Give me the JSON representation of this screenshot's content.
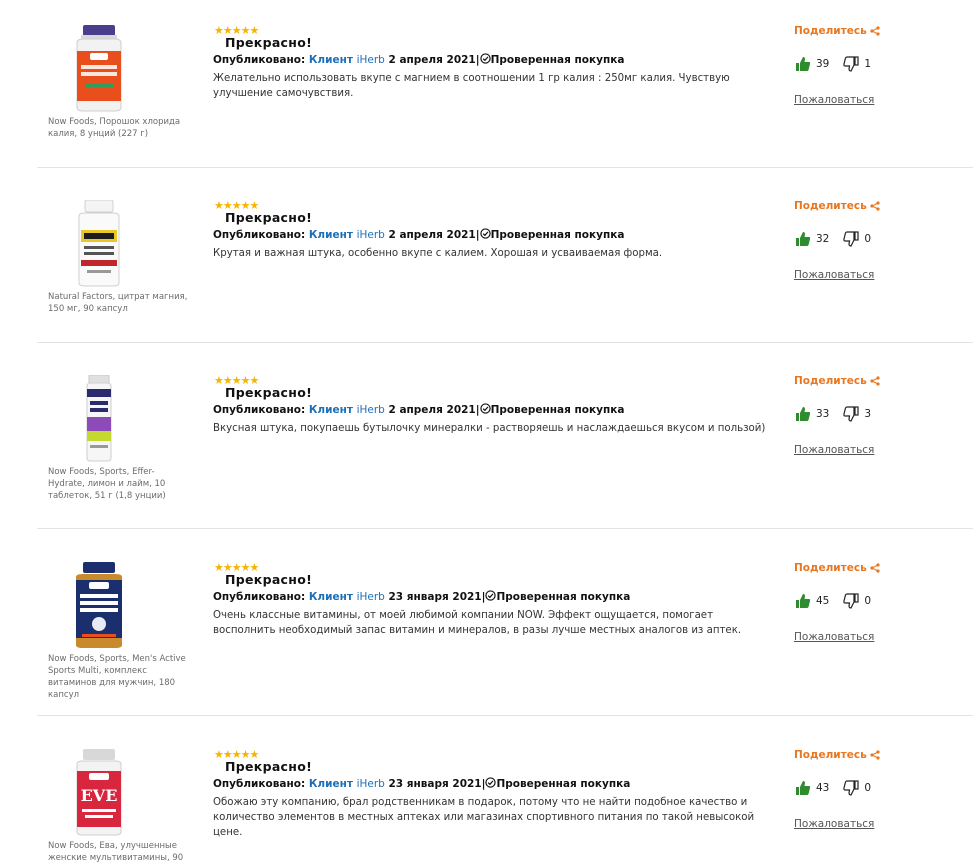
{
  "labels": {
    "stars": "★★★★★",
    "published": "Опубликовано:",
    "client_prefix": "Клиент",
    "client_brand": "iHerb",
    "verified": "Проверенная покупка",
    "share": "Поделитесь",
    "report": "Пожаловаться"
  },
  "colors": {
    "accent": "#e87722",
    "link": "#1d6fb8",
    "star": "#f5b400",
    "thumb_up": "#2e8b2e"
  },
  "reviews": [
    {
      "product_name": "Now Foods, Порошок хлорида калия, 8 унций (227 г)",
      "product_label": "Potassium Chloride Powder",
      "title": "Прекрасно!",
      "date": "2 апреля 2021",
      "text": "Желательно использовать вкупе с магнием в соотношении 1 гр калия : 250мг калия. Чувствую улучшение самочувствия.",
      "helpful": "39",
      "unhelpful": "1"
    },
    {
      "product_name": "Natural Factors, цитрат магния, 150 мг, 90 капсул",
      "product_label": "Magnesium Citrate",
      "title": "Прекрасно!",
      "date": "2 апреля 2021",
      "text": "Крутая и важная штука, особенно вкупе с калием. Хорошая и усваиваемая форма.",
      "helpful": "32",
      "unhelpful": "0"
    },
    {
      "product_name": "Now Foods, Sports, Effer-Hydrate, лимон и лайм, 10 таблеток, 51 г (1,8 унции)",
      "product_label": "EFFER-HYDRATE",
      "title": "Прекрасно!",
      "date": "2 апреля 2021",
      "text": "Вкусная штука, покупаешь бутылочку минералки - растворяешь и наслаждаешься вкусом и пользой)",
      "helpful": "33",
      "unhelpful": "3"
    },
    {
      "product_name": "Now Foods, Sports, Men's Active Sports Multi, комплекс витаминов для мужчин, 180 капсул",
      "product_label": "MEN'S ACTIVE SPORTS MULTI",
      "title": "Прекрасно!",
      "date": "23 января 2021",
      "text": "Очень классные витамины, от моей любимой компании NOW. Эффект ощущается, помогает восполнить необходимый запас витамин и минералов, в разы лучше местных аналогов из аптек.",
      "helpful": "45",
      "unhelpful": "0"
    },
    {
      "product_name": "Now Foods, Ева, улучшенные женские мультивитамины, 90",
      "product_label": "EVE",
      "title": "Прекрасно!",
      "date": "23 января 2021",
      "text": "Обожаю эту компанию, брал родственникам в подарок, потому что не найти подобное качество и количество элементов в местных аптеках или магазинах спортивного питания по такой невысокой цене.",
      "helpful": "43",
      "unhelpful": "0"
    }
  ]
}
